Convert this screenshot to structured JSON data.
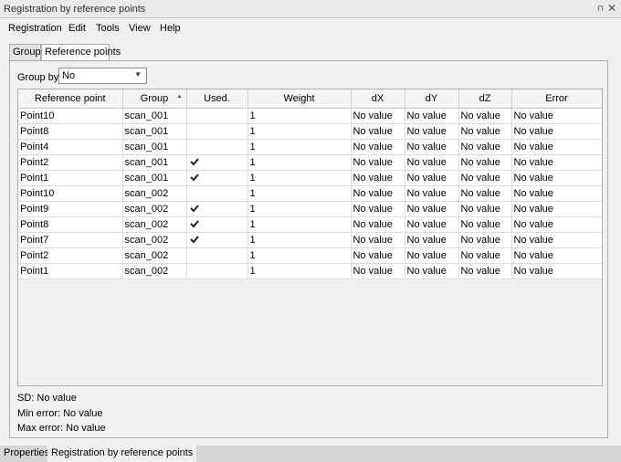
{
  "window": {
    "title": "Registration by reference points"
  },
  "menu": [
    "Registration",
    "Edit",
    "Tools",
    "View",
    "Help"
  ],
  "tabs": [
    "Groups",
    "Reference points"
  ],
  "group_by": {
    "label": "Group by:",
    "value": "No"
  },
  "table": {
    "columns": [
      "Reference point",
      "Group",
      "Used.",
      "Weight",
      "dX",
      "dY",
      "dZ",
      "Error"
    ],
    "rows": [
      {
        "point": "Point10",
        "group": "scan_001",
        "used": false,
        "weight": "1",
        "dx": "No value",
        "dy": "No value",
        "dz": "No value",
        "error": "No value"
      },
      {
        "point": "Point8",
        "group": "scan_001",
        "used": false,
        "weight": "1",
        "dx": "No value",
        "dy": "No value",
        "dz": "No value",
        "error": "No value"
      },
      {
        "point": "Point4",
        "group": "scan_001",
        "used": false,
        "weight": "1",
        "dx": "No value",
        "dy": "No value",
        "dz": "No value",
        "error": "No value"
      },
      {
        "point": "Point2",
        "group": "scan_001",
        "used": true,
        "weight": "1",
        "dx": "No value",
        "dy": "No value",
        "dz": "No value",
        "error": "No value"
      },
      {
        "point": "Point1",
        "group": "scan_001",
        "used": true,
        "weight": "1",
        "dx": "No value",
        "dy": "No value",
        "dz": "No value",
        "error": "No value"
      },
      {
        "point": "Point10",
        "group": "scan_002",
        "used": false,
        "weight": "1",
        "dx": "No value",
        "dy": "No value",
        "dz": "No value",
        "error": "No value"
      },
      {
        "point": "Point9",
        "group": "scan_002",
        "used": true,
        "weight": "1",
        "dx": "No value",
        "dy": "No value",
        "dz": "No value",
        "error": "No value"
      },
      {
        "point": "Point8",
        "group": "scan_002",
        "used": true,
        "weight": "1",
        "dx": "No value",
        "dy": "No value",
        "dz": "No value",
        "error": "No value"
      },
      {
        "point": "Point7",
        "group": "scan_002",
        "used": true,
        "weight": "1",
        "dx": "No value",
        "dy": "No value",
        "dz": "No value",
        "error": "No value"
      },
      {
        "point": "Point2",
        "group": "scan_002",
        "used": false,
        "weight": "1",
        "dx": "No value",
        "dy": "No value",
        "dz": "No value",
        "error": "No value"
      },
      {
        "point": "Point1",
        "group": "scan_002",
        "used": false,
        "weight": "1",
        "dx": "No value",
        "dy": "No value",
        "dz": "No value",
        "error": "No value"
      }
    ]
  },
  "stats": {
    "sd": "SD: No value",
    "min_error": "Min error: No value",
    "max_error": "Max error: No value"
  },
  "bottom_tabs": [
    "Properties",
    "Registration by reference points"
  ],
  "icons": {
    "check": "checkmark-icon",
    "close": "close-icon",
    "pin": "pin-icon",
    "sort": "sort-ascending-icon",
    "dropdown": "chevron-down-icon"
  }
}
